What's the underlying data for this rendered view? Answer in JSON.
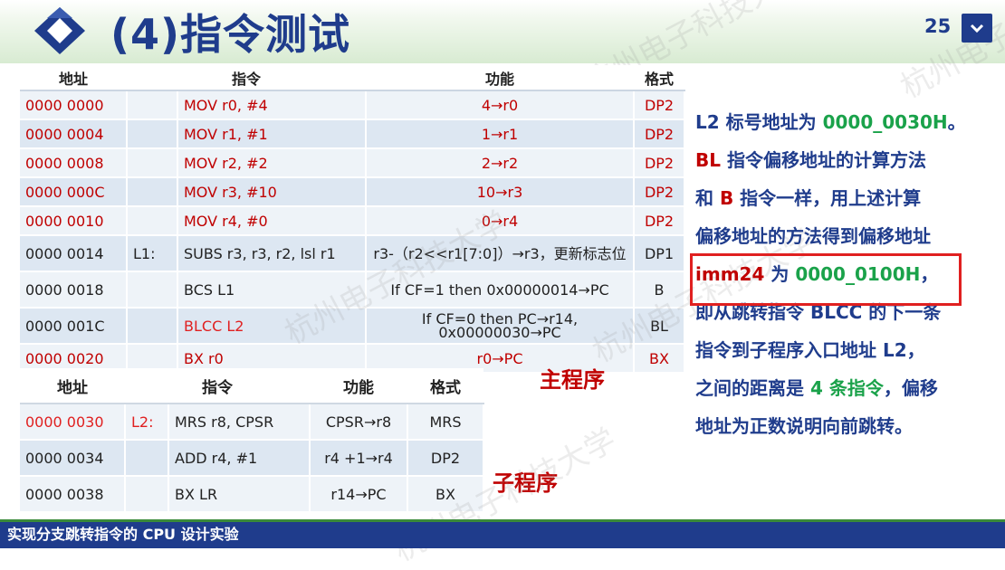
{
  "header": {
    "title": "(4)指令测试",
    "page_number": "25",
    "watermark": "杭州电子科技大学"
  },
  "main_table": {
    "headers": [
      "地址",
      "指令",
      "功能",
      "格式"
    ],
    "rows": [
      {
        "addr": "0000 0000",
        "label": "",
        "instr": "MOV r0, #4",
        "func": "4→r0",
        "fmt": "DP2"
      },
      {
        "addr": "0000 0004",
        "label": "",
        "instr": "MOV r1, #1",
        "func": "1→r1",
        "fmt": "DP2"
      },
      {
        "addr": "0000 0008",
        "label": "",
        "instr": "MOV r2, #2",
        "func": "2→r2",
        "fmt": "DP2"
      },
      {
        "addr": "0000 000C",
        "label": "",
        "instr": "MOV r3, #10",
        "func": "10→r3",
        "fmt": "DP2"
      },
      {
        "addr": "0000 0010",
        "label": "",
        "instr": "MOV r4, #0",
        "func": "0→r4",
        "fmt": "DP2"
      },
      {
        "addr": "0000 0014",
        "label": "L1:",
        "instr": "SUBS r3, r3, r2, lsl r1",
        "func": "r3-（r2<<r1[7:0]）→r3，更新标志位",
        "fmt": "DP1"
      },
      {
        "addr": "0000 0018",
        "label": "",
        "instr": "BCS L1",
        "func": "If CF=1 then 0x00000014→PC",
        "fmt": "B"
      },
      {
        "addr": "0000 001C",
        "label": "",
        "instr": "BLCC L2",
        "func": "If CF=0 then PC→r14, 0x00000030→PC",
        "fmt": "BL"
      },
      {
        "addr": "0000 0020",
        "label": "",
        "instr": "BX r0",
        "func": "r0→PC",
        "fmt": "BX"
      }
    ]
  },
  "main_label": "主程序",
  "sub_table": {
    "headers": [
      "地址",
      "指令",
      "功能",
      "格式"
    ],
    "rows": [
      {
        "addr": "0000 0030",
        "label": "L2:",
        "instr": "MRS r8, CPSR",
        "func": "CPSR→r8",
        "fmt": "MRS"
      },
      {
        "addr": "0000 0034",
        "label": "",
        "instr": "ADD r4, #1",
        "func": "r4 +1→r4",
        "fmt": "DP2"
      },
      {
        "addr": "0000 0038",
        "label": "",
        "instr": "BX LR",
        "func": "r14→PC",
        "fmt": "BX"
      }
    ]
  },
  "sub_label": "子程序",
  "explanation": {
    "l1_a": "L2 标号地址为 ",
    "l1_b": "0000_0030H",
    "l1_c": "。",
    "l2_a": "BL",
    "l2_b": " 指令偏移地址的计算方法",
    "l3_a": "和 ",
    "l3_b": "B",
    "l3_c": " 指令一样，用上述计算",
    "l4": "偏移地址的方法得到偏移地址",
    "l5_a": "imm24",
    "l5_b": " 为 ",
    "l5_c": "0000_0100H",
    "l5_d": "，",
    "l6": "即从跳转指令 BLCC 的下一条",
    "l7": "指令到子程序入口地址 L2，",
    "l8_a": "之间的距离是 ",
    "l8_b": "4 条指令",
    "l8_c": "，偏移",
    "l9": "地址为正数说明向前跳转。"
  },
  "footer": {
    "text": "实现分支跳转指令的 CPU 设计实验"
  },
  "colors": {
    "title_blue": "#1f3c8c",
    "green": "#1aa24a",
    "red": "#c00000",
    "row_a": "#dde7f2",
    "row_b": "#eef3f8"
  }
}
